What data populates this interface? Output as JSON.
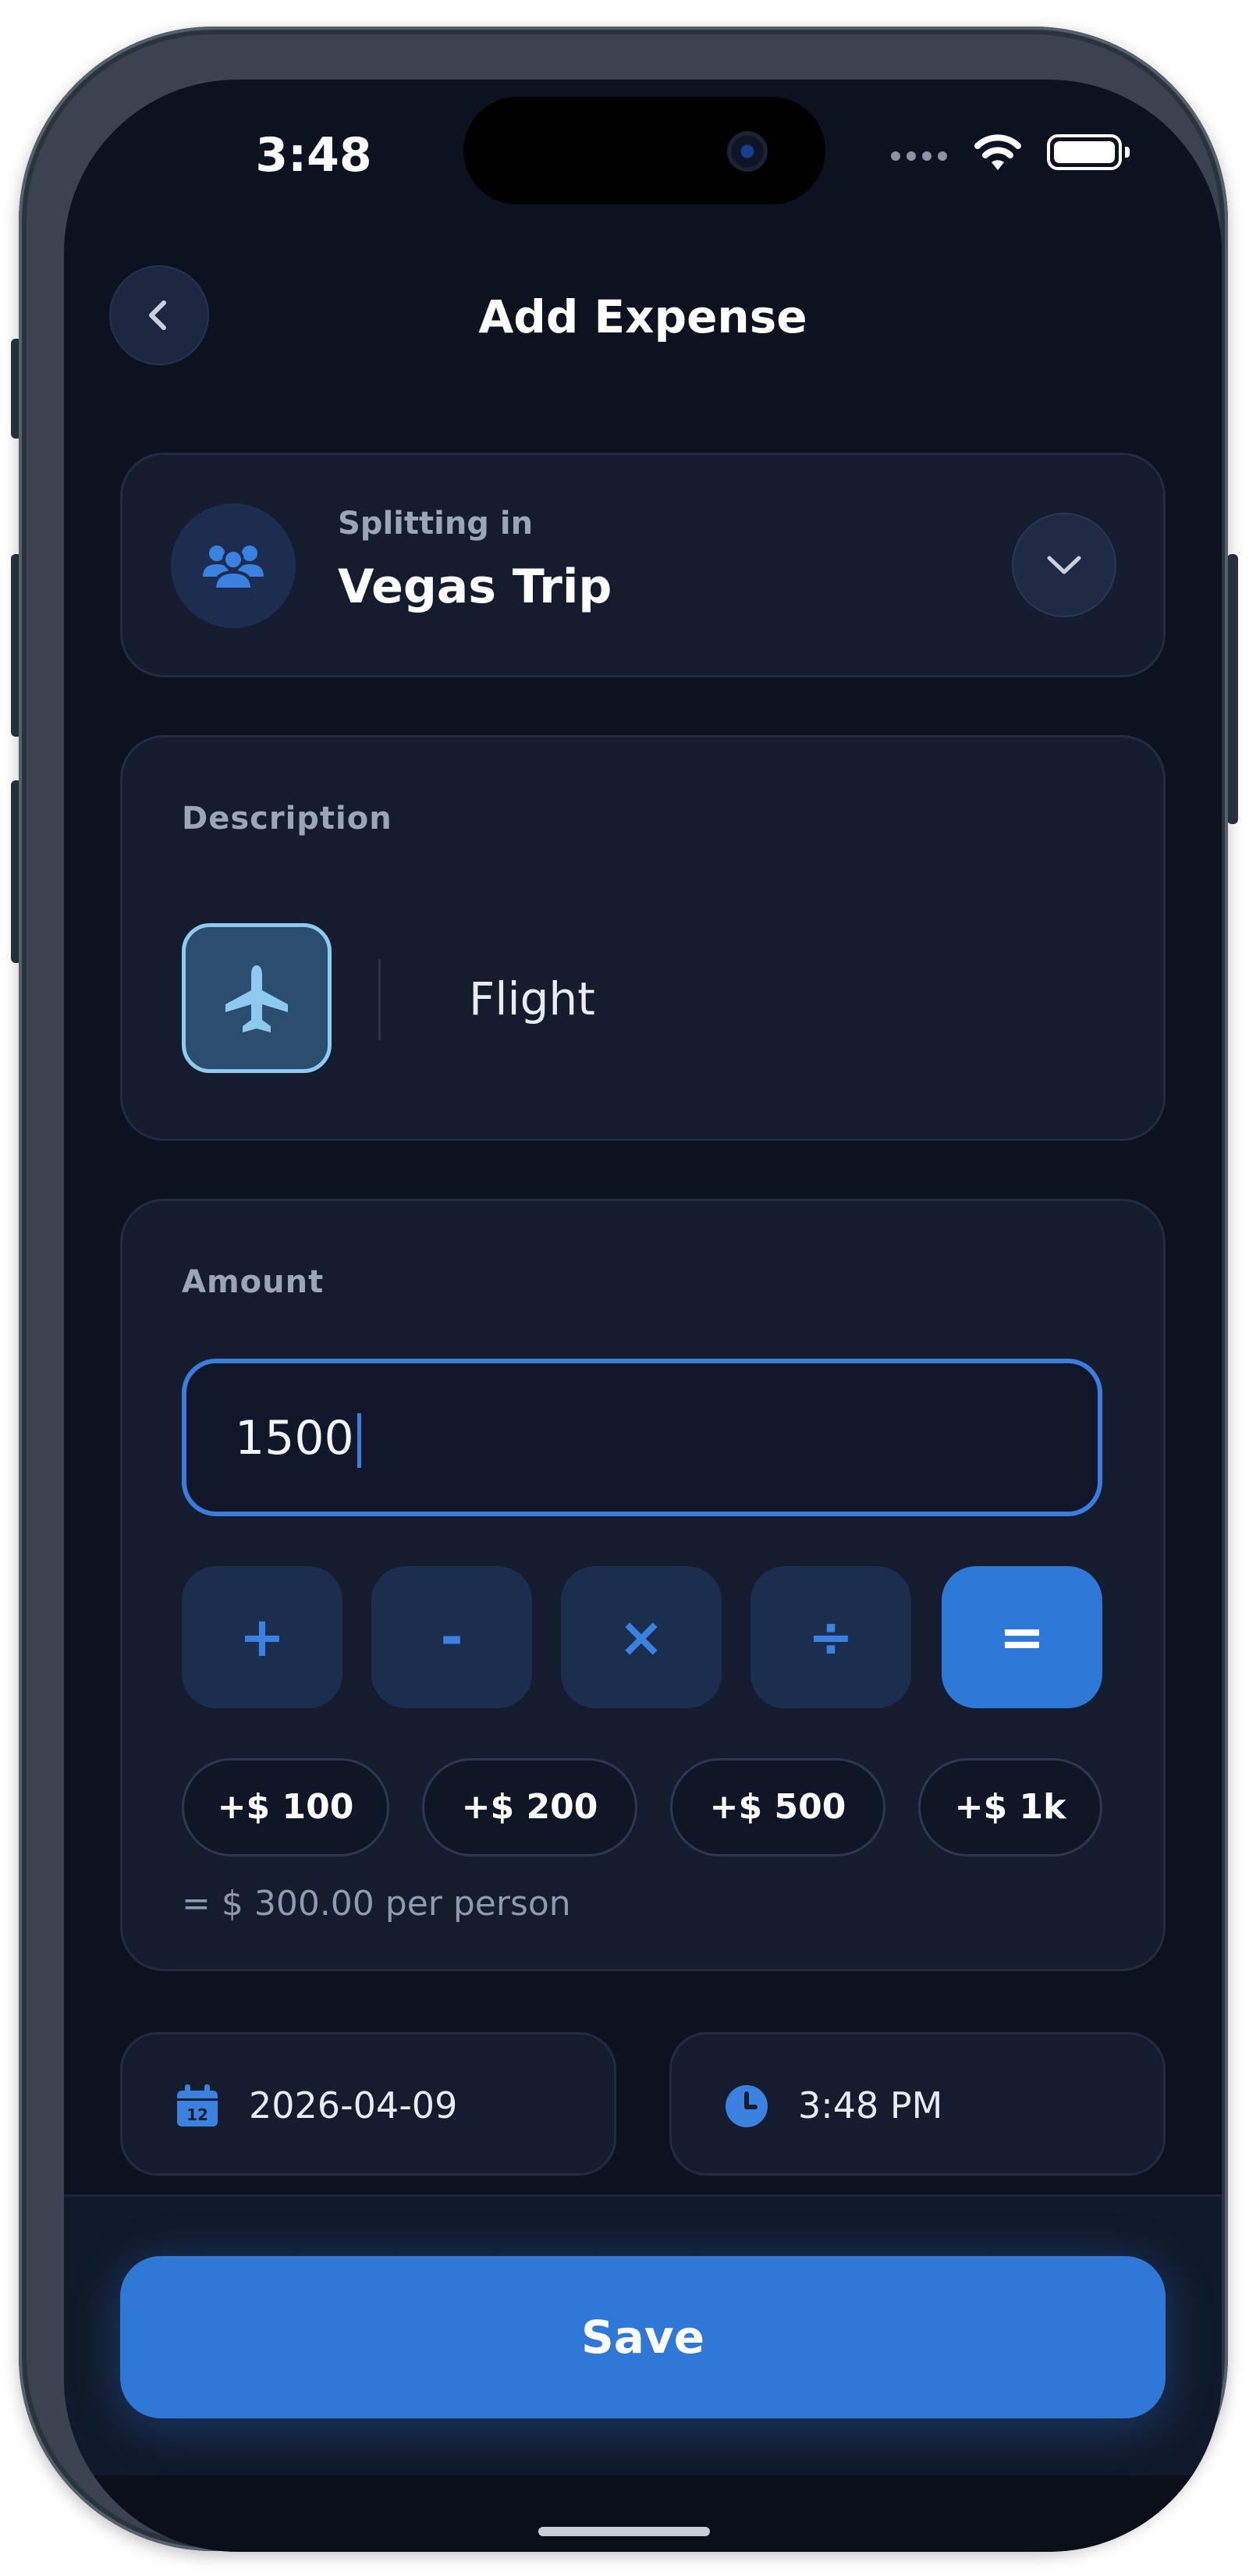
{
  "status_bar": {
    "time": "3:48"
  },
  "header": {
    "title": "Add Expense"
  },
  "group": {
    "label": "Splitting in",
    "name": "Vegas Trip"
  },
  "description": {
    "label": "Description",
    "value": "Flight"
  },
  "amount": {
    "label": "Amount",
    "value": "1500",
    "operators": [
      "+",
      "-",
      "×",
      "÷",
      "="
    ],
    "quick_add": [
      "+$ 100",
      "+$ 200",
      "+$ 500",
      "+$ 1k"
    ],
    "per_person": "= $ 300.00 per person"
  },
  "date": {
    "value": "2026-04-09",
    "calendar_day": "12"
  },
  "time": {
    "value": "3:48 PM"
  },
  "save_label": "Save",
  "colors": {
    "accent": "#2F78D8",
    "background": "#0C1220",
    "card": "#141C2E",
    "muted_text": "#9AA6B8"
  }
}
